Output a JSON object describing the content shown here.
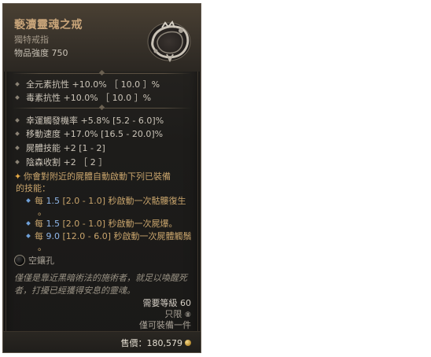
{
  "item": {
    "name": "褻瀆靈魂之戒",
    "type": "獨特戒指",
    "item_power": "物品強度 750",
    "icon": "ring-icon"
  },
  "implicits": [
    "全元素抗性 +10.0% ［ 10.0 ］%",
    "毒素抗性 +10.0% ［ 10.0 ］%"
  ],
  "affixes": [
    "幸運觸發機率 +5.8% [5.2 - 6.0]%",
    "移動速度 +17.0% [16.5 - 20.0]%",
    "屍體技能 +2 [1 - 2]",
    "陰森收割 +2 ［ 2 ］"
  ],
  "legendary": {
    "line1": "你會對附近的屍體自動啟動下列已裝備",
    "line2": "的技能：",
    "subs": [
      {
        "prefix": "每 ",
        "value": "1.5",
        "range": " [2.0 - 1.0] 秒啟動一次骷髏復生",
        "cont": "。"
      },
      {
        "prefix": "每 ",
        "value": "1.5",
        "range": " [2.0 - 1.0] 秒啟動一次屍爆。",
        "cont": ""
      },
      {
        "prefix": "每 ",
        "value": "9.0",
        "range": " [12.0 - 6.0] 秒啟動一次屍體觸鬚",
        "cont": "。"
      }
    ]
  },
  "socket": {
    "label": "空鑲孔"
  },
  "flavor": "僅僅是靠近黑暗術法的施術者，就足以喚醒死者，打擾已經獲得安息的靈魂。",
  "requirements": {
    "level": "需要等級 60",
    "unique": "只限",
    "unique_mark": "⑧",
    "equip_limit": "僅可裝備一件"
  },
  "price": {
    "label": "售價：",
    "value": "180,579"
  },
  "colors": {
    "title": "#c9a57a",
    "legendary_text": "#c8a46c",
    "value_highlight": "#8fb6e8"
  }
}
